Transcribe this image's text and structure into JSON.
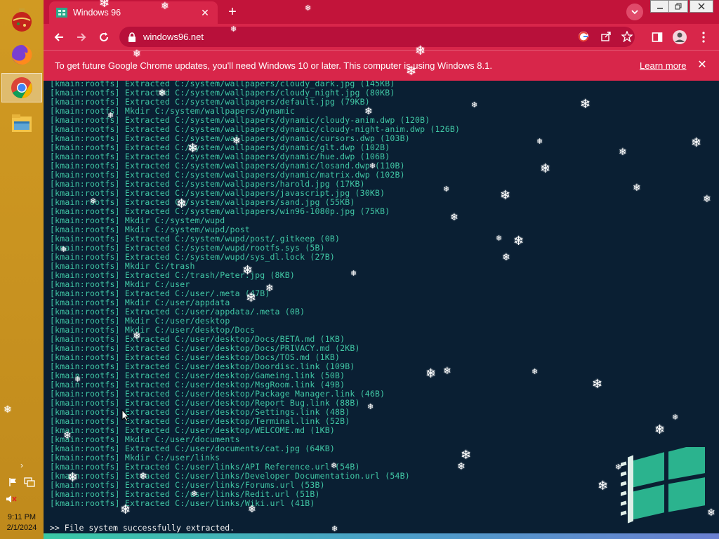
{
  "taskbar": {
    "apps": [
      {
        "name": "christmas-ornament-icon"
      },
      {
        "name": "firefox-icon"
      },
      {
        "name": "chrome-icon",
        "active": true
      },
      {
        "name": "file-explorer-icon"
      }
    ],
    "tray": {
      "chevron": "›",
      "flag_icon": "flag-icon",
      "network_icon": "network-icon",
      "volume_icon": "volume-muted-icon"
    },
    "clock": {
      "time": "9:11 PM",
      "date": "2/1/2024"
    }
  },
  "browser": {
    "tab": {
      "title": "Windows 96",
      "close": "✕"
    },
    "new_tab": "+",
    "address": {
      "url": "windows96.net"
    },
    "infobar": {
      "message": "To get future Google Chrome updates, you'll need Windows 10 or later. This computer is using Windows 8.1.",
      "link": "Learn more",
      "close": "✕"
    }
  },
  "terminal": {
    "lines": [
      "[kmain:rootfs] Extracted C:/system/wallpapers/cloudy_dark.jpg (145KB)",
      "[kmain:rootfs] Extracted C:/system/wallpapers/cloudy_night.jpg (80KB)",
      "[kmain:rootfs] Extracted C:/system/wallpapers/default.jpg (79KB)",
      "[kmain:rootfs] Mkdir C:/system/wallpapers/dynamic",
      "[kmain:rootfs] Extracted C:/system/wallpapers/dynamic/cloudy-anim.dwp (120B)",
      "[kmain:rootfs] Extracted C:/system/wallpapers/dynamic/cloudy-night-anim.dwp (126B)",
      "[kmain:rootfs] Extracted C:/system/wallpapers/dynamic/cursors.dwp (103B)",
      "[kmain:rootfs] Extracted C:/system/wallpapers/dynamic/glt.dwp (102B)",
      "[kmain:rootfs] Extracted C:/system/wallpapers/dynamic/hue.dwp (106B)",
      "[kmain:rootfs] Extracted C:/system/wallpapers/dynamic/losand.dwp (110B)",
      "[kmain:rootfs] Extracted C:/system/wallpapers/dynamic/matrix.dwp (102B)",
      "[kmain:rootfs] Extracted C:/system/wallpapers/harold.jpg (17KB)",
      "[kmain:rootfs] Extracted C:/system/wallpapers/javascript.jpg (30KB)",
      "[kmain:rootfs] Extracted C:/system/wallpapers/sand.jpg (55KB)",
      "[kmain:rootfs] Extracted C:/system/wallpapers/win96-1080p.jpg (75KB)",
      "[kmain:rootfs] Mkdir C:/system/wupd",
      "[kmain:rootfs] Mkdir C:/system/wupd/post",
      "[kmain:rootfs] Extracted C:/system/wupd/post/.gitkeep (0B)",
      "[kmain:rootfs] Extracted C:/system/wupd/rootfs.sys (5B)",
      "[kmain:rootfs] Extracted C:/system/wupd/sys_dl.lock (27B)",
      "[kmain:rootfs] Mkdir C:/trash",
      "[kmain:rootfs] Extracted C:/trash/Peter.jpg (8KB)",
      "[kmain:rootfs] Mkdir C:/user",
      "[kmain:rootfs] Extracted C:/user/.meta (47B)",
      "[kmain:rootfs] Mkdir C:/user/appdata",
      "[kmain:rootfs] Extracted C:/user/appdata/.meta (0B)",
      "[kmain:rootfs] Mkdir C:/user/desktop",
      "[kmain:rootfs] Mkdir C:/user/desktop/Docs",
      "[kmain:rootfs] Extracted C:/user/desktop/Docs/BETA.md (1KB)",
      "[kmain:rootfs] Extracted C:/user/desktop/Docs/PRIVACY.md (2KB)",
      "[kmain:rootfs] Extracted C:/user/desktop/Docs/TOS.md (1KB)",
      "[kmain:rootfs] Extracted C:/user/desktop/Doordisc.link (109B)",
      "[kmain:rootfs] Extracted C:/user/desktop/Gameing.link (50B)",
      "[kmain:rootfs] Extracted C:/user/desktop/MsgRoom.link (49B)",
      "[kmain:rootfs] Extracted C:/user/desktop/Package Manager.link (46B)",
      "[kmain:rootfs] Extracted C:/user/desktop/Report Bug.link (88B)",
      "[kmain:rootfs] Extracted C:/user/desktop/Settings.link (48B)",
      "[kmain:rootfs] Extracted C:/user/desktop/Terminal.link (52B)",
      "[kmain:rootfs] Extracted C:/user/desktop/WELCOME.md (1KB)",
      "[kmain:rootfs] Mkdir C:/user/documents",
      "[kmain:rootfs] Extracted C:/user/documents/cat.jpg (64KB)",
      "[kmain:rootfs] Mkdir C:/user/links",
      "[kmain:rootfs] Extracted C:/user/links/API Reference.url (54B)",
      "[kmain:rootfs] Extracted C:/user/links/Developer Documentation.url (54B)",
      "[kmain:rootfs] Extracted C:/user/links/Forums.url (53B)",
      "[kmain:rootfs] Extracted C:/user/links/Redit.url (51B)",
      "[kmain:rootfs] Extracted C:/user/links/Wiki.url (41B)"
    ],
    "prompt": ">> File system successfully extracted."
  },
  "colors": {
    "terminal_bg": "#0a1f33",
    "terminal_text": "#41c8a6",
    "chrome_theme": "#d8264a",
    "taskbar": "#c99320"
  }
}
